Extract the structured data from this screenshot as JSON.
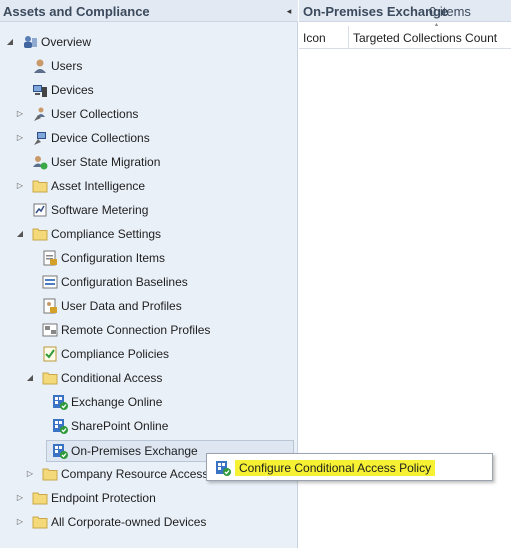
{
  "nav": {
    "title": "Assets and Compliance",
    "collapse_glyph": "◂",
    "items": [
      {
        "label": "Overview",
        "icon": "overview-icon",
        "expander": "expanded"
      },
      {
        "label": "Users",
        "icon": "user-icon",
        "expander": "none"
      },
      {
        "label": "Devices",
        "icon": "devices-icon",
        "expander": "none"
      },
      {
        "label": "User Collections",
        "icon": "user-collections-icon",
        "expander": "collapsed"
      },
      {
        "label": "Device Collections",
        "icon": "device-collections-icon",
        "expander": "collapsed"
      },
      {
        "label": "User State Migration",
        "icon": "user-state-migration-icon",
        "expander": "none"
      },
      {
        "label": "Asset Intelligence",
        "icon": "folder-icon",
        "expander": "collapsed"
      },
      {
        "label": "Software Metering",
        "icon": "software-metering-icon",
        "expander": "none"
      },
      {
        "label": "Compliance Settings",
        "icon": "folder-icon",
        "expander": "expanded"
      },
      {
        "label": "Configuration Items",
        "icon": "configuration-items-icon",
        "expander": "none"
      },
      {
        "label": "Configuration Baselines",
        "icon": "configuration-baselines-icon",
        "expander": "none"
      },
      {
        "label": "User Data and Profiles",
        "icon": "user-data-profiles-icon",
        "expander": "none"
      },
      {
        "label": "Remote Connection Profiles",
        "icon": "remote-connection-icon",
        "expander": "none"
      },
      {
        "label": "Compliance Policies",
        "icon": "compliance-policies-icon",
        "expander": "none"
      },
      {
        "label": "Conditional Access",
        "icon": "folder-icon",
        "expander": "expanded"
      },
      {
        "label": "Exchange Online",
        "icon": "exchange-icon",
        "expander": "none"
      },
      {
        "label": "SharePoint Online",
        "icon": "exchange-icon",
        "expander": "none"
      },
      {
        "label": "On-Premises Exchange",
        "icon": "exchange-icon",
        "expander": "none"
      },
      {
        "label": "Company Resource Access",
        "icon": "folder-icon",
        "expander": "collapsed"
      },
      {
        "label": "Endpoint Protection",
        "icon": "folder-icon",
        "expander": "collapsed"
      },
      {
        "label": "All Corporate-owned Devices",
        "icon": "folder-icon",
        "expander": "collapsed"
      }
    ]
  },
  "content": {
    "title": "On-Premises Exchange",
    "count": "0 items",
    "columns": [
      "Icon",
      "Targeted Collections Count"
    ],
    "sort_glyph": "▲"
  },
  "context_menu": {
    "item_label": "Configure Conditional Access Policy",
    "highlight_color": "#f6f233"
  },
  "colors": {
    "nav_bg": "#eaf0f8",
    "header_bg": "#e2e9f3",
    "selected_bg": "#dde6f1"
  }
}
